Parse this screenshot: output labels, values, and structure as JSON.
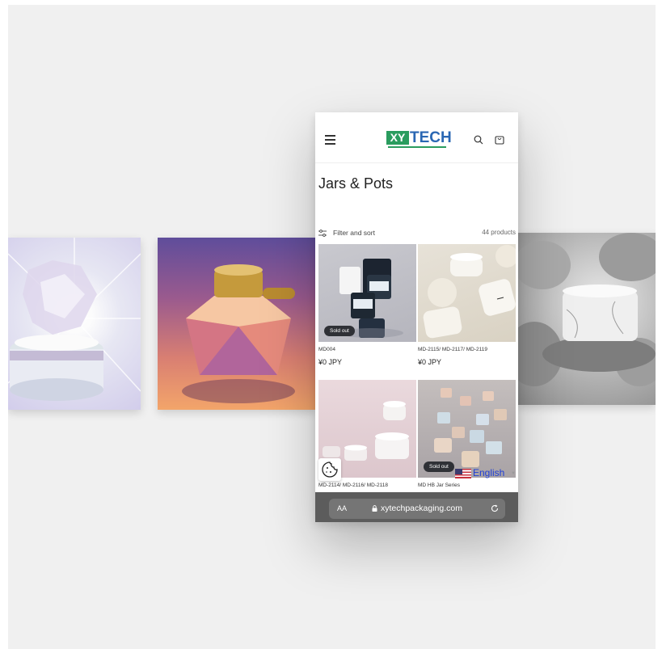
{
  "phone": {
    "logo": {
      "xy": "XY",
      "tech": "TECH"
    },
    "page_title": "Jars & Pots",
    "filter": {
      "label": "Filter and sort",
      "count": "44 products"
    },
    "products": [
      {
        "name": "MD004",
        "price": "¥0 JPY",
        "badge": "Sold out"
      },
      {
        "name": "MD-2115/ MD-2117/ MD-2119",
        "price": "¥0 JPY",
        "badge": ""
      },
      {
        "name": "MD-2114/ MD-2116/ MD-2118",
        "price": "",
        "badge": ""
      },
      {
        "name": "MD HB Jar Series",
        "price": "",
        "badge": "Sold out"
      }
    ],
    "language": {
      "label": "English"
    },
    "browser": {
      "aa": "AA",
      "url": "xytechpackaging.com"
    }
  },
  "icons": [
    "menu-icon",
    "search-icon",
    "cart-icon",
    "filter-icon",
    "cookie-icon",
    "lock-icon",
    "reload-icon",
    "us-flag-icon"
  ]
}
